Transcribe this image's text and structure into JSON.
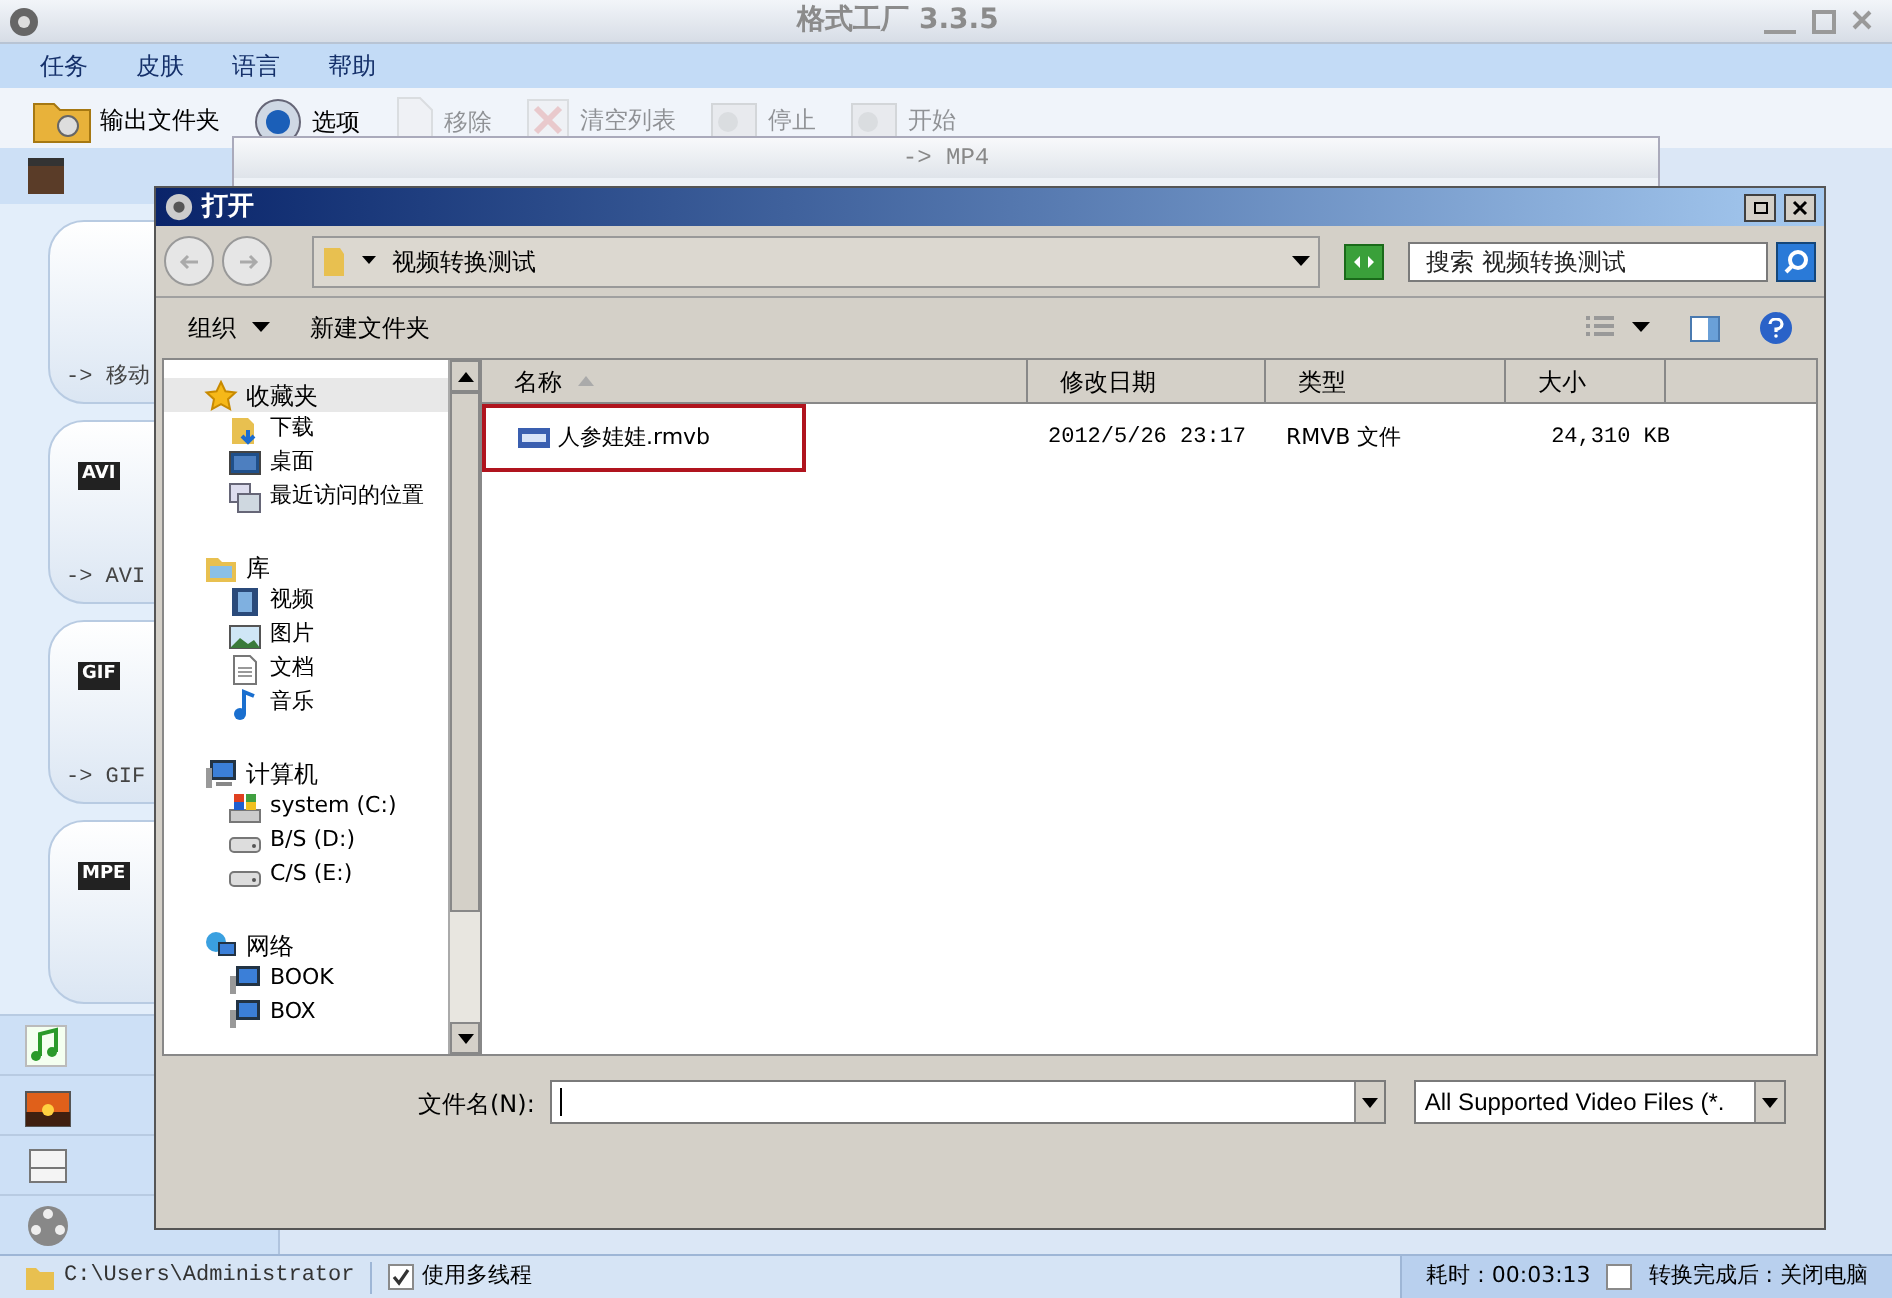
{
  "window": {
    "title": "格式工厂 3.3.5"
  },
  "menu": [
    "任务",
    "皮肤",
    "语言",
    "帮助"
  ],
  "toolbar": [
    {
      "label": "输出文件夹",
      "kind": "folder",
      "disabled": false
    },
    {
      "label": "选项",
      "kind": "gear",
      "disabled": false
    },
    {
      "label": "移除",
      "kind": "remove",
      "disabled": true
    },
    {
      "label": "清空列表",
      "kind": "clear",
      "disabled": true
    },
    {
      "label": "停止",
      "kind": "stop",
      "disabled": true
    },
    {
      "label": "开始",
      "kind": "start",
      "disabled": true
    }
  ],
  "format_cards": [
    {
      "label": "-> 移动"
    },
    {
      "label": "-> AVI",
      "badge": "AVI"
    },
    {
      "label": "-> GIF",
      "badge": "GIF"
    },
    {
      "badge": "MPE"
    }
  ],
  "sidebar_categories": [
    {
      "kind": "video"
    },
    {
      "kind": "music"
    },
    {
      "kind": "picture"
    },
    {
      "kind": "disc"
    },
    {
      "kind": "reel"
    }
  ],
  "convert_window": {
    "title": "-> MP4"
  },
  "open_dialog": {
    "title": "打开",
    "address": "视频转换测试",
    "search_placeholder": "搜索 视频转换测试",
    "commands": [
      {
        "label": "组织",
        "dropdown": true
      },
      {
        "label": "新建文件夹",
        "dropdown": false
      }
    ],
    "nav": [
      {
        "label": "收藏夹",
        "kind": "star",
        "selected": true,
        "children": [
          {
            "label": "下载",
            "kind": "download",
            "selected": false
          },
          {
            "label": "桌面",
            "kind": "desktop",
            "selected": false
          },
          {
            "label": "最近访问的位置",
            "kind": "recent",
            "selected": false
          }
        ]
      },
      {
        "label": "库",
        "kind": "library",
        "selected": false,
        "children": [
          {
            "label": "视频",
            "kind": "video",
            "selected": false
          },
          {
            "label": "图片",
            "kind": "picture",
            "selected": false
          },
          {
            "label": "文档",
            "kind": "document",
            "selected": false
          },
          {
            "label": "音乐",
            "kind": "music",
            "selected": false
          }
        ]
      },
      {
        "label": "计算机",
        "kind": "computer",
        "selected": false,
        "children": [
          {
            "label": "system (C:)",
            "kind": "system-drive",
            "selected": false
          },
          {
            "label": "B/S (D:)",
            "kind": "drive",
            "selected": false
          },
          {
            "label": "C/S (E:)",
            "kind": "drive",
            "selected": false
          }
        ]
      },
      {
        "label": "网络",
        "kind": "network",
        "selected": false,
        "children": [
          {
            "label": "BOOK",
            "kind": "pc",
            "selected": false
          },
          {
            "label": "BOX",
            "kind": "pc",
            "selected": false
          }
        ]
      }
    ],
    "columns": [
      "名称",
      "修改日期",
      "类型",
      "大小"
    ],
    "files": [
      {
        "name": "人参娃娃.rmvb",
        "modified": "2012/5/26 23:17",
        "type": "RMVB 文件",
        "size": "24,310 KB",
        "highlighted": true
      }
    ],
    "filename_label": "文件名(N):",
    "file_type": "All Supported Video Files (*."
  },
  "status_bar": {
    "path": "C:\\Users\\Administrator",
    "multithread": {
      "label": "使用多线程",
      "checked": true
    },
    "elapsed": "耗时 : 00:03:13",
    "shutdown": {
      "label": "转换完成后 : 关闭电脑",
      "checked": false
    }
  }
}
